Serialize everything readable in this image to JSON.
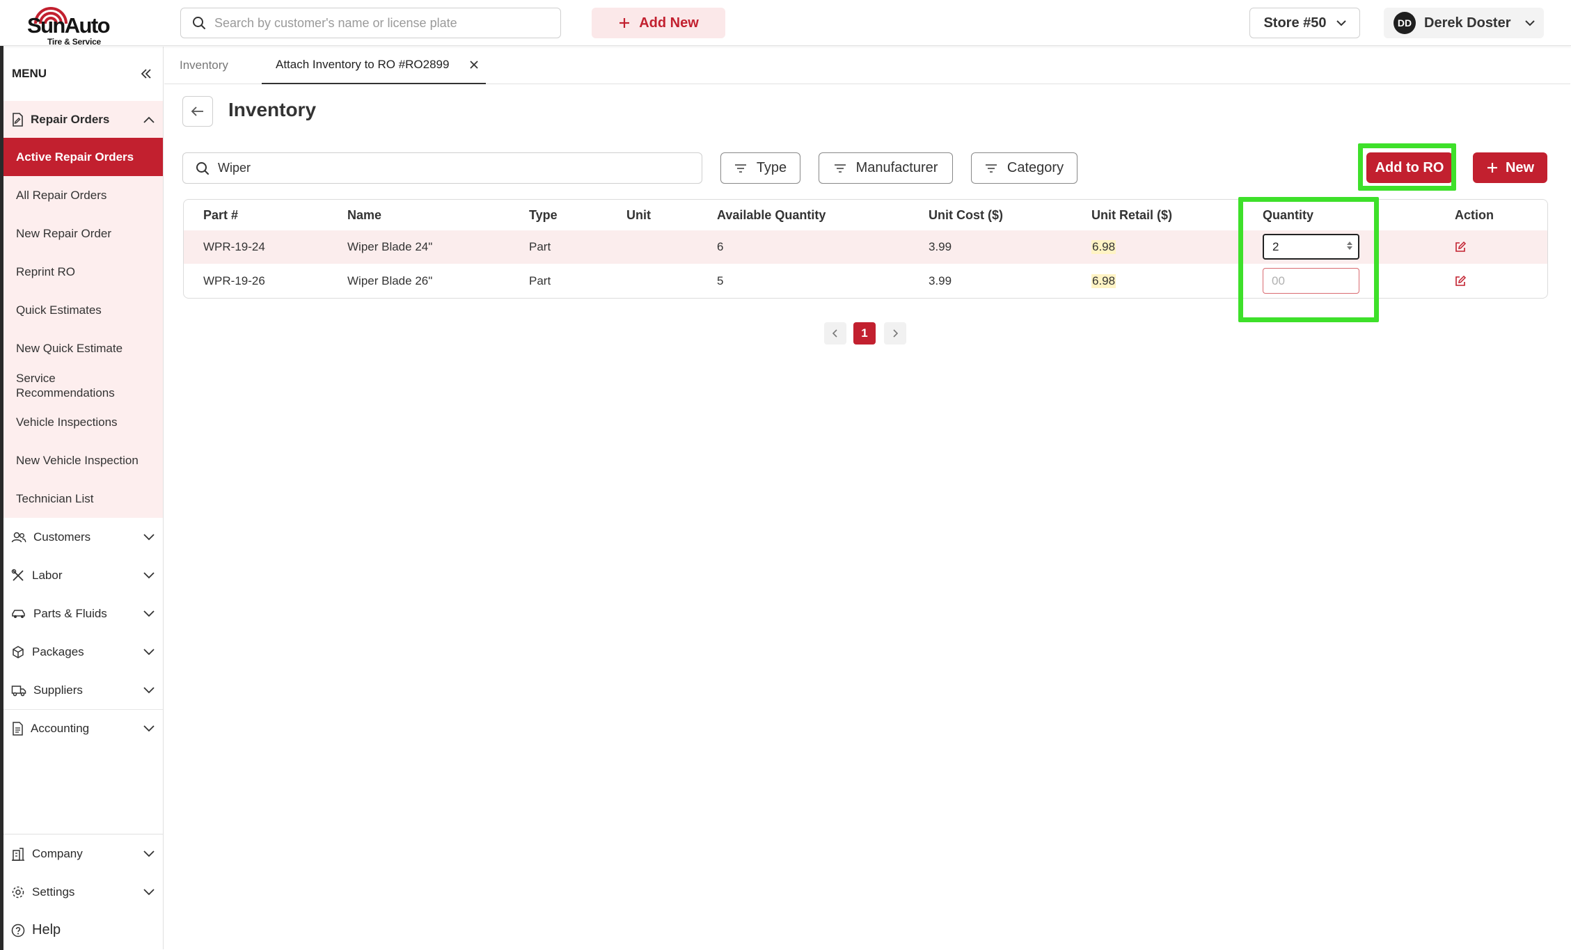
{
  "brand": {
    "name_part1": "Sun",
    "name_part2": "Auto",
    "tagline": "Tire & Service",
    "accent_color": "#c2202f"
  },
  "topbar": {
    "search_placeholder": "Search by customer's name or license plate",
    "add_new_label": "Add New",
    "store_label": "Store #50",
    "user_initials": "DD",
    "user_name": "Derek Doster"
  },
  "sidebar": {
    "menu_label": "MENU",
    "repair_orders": {
      "label": "Repair Orders",
      "items": [
        "Active Repair Orders",
        "All Repair Orders",
        "New Repair Order",
        "Reprint RO",
        "Quick Estimates",
        "New Quick Estimate",
        "Service Recommendations",
        "Vehicle Inspections",
        "New Vehicle Inspection",
        "Technician List"
      ],
      "active_item": "Active Repair Orders"
    },
    "groups": [
      "Customers",
      "Labor",
      "Parts & Fluids",
      "Packages",
      "Suppliers",
      "Accounting"
    ],
    "bottom_groups": [
      "Company",
      "Settings"
    ],
    "help_label": "Help"
  },
  "tabs": [
    {
      "label": "Inventory",
      "active": false
    },
    {
      "label": "Attach Inventory to RO #RO2899",
      "active": true
    }
  ],
  "main": {
    "title": "Inventory",
    "search_value": "Wiper",
    "filters": [
      "Type",
      "Manufacturer",
      "Category"
    ],
    "add_to_ro_label": "Add to RO",
    "new_label": "New"
  },
  "table": {
    "columns": [
      "Part #",
      "Name",
      "Type",
      "Unit",
      "Available Quantity",
      "Unit Cost ($)",
      "Unit Retail ($)",
      "Quantity",
      "Action"
    ],
    "rows": [
      {
        "part": "WPR-19-24",
        "name": "Wiper Blade 24\"",
        "type": "Part",
        "unit": "",
        "available": "6",
        "unit_cost": "3.99",
        "unit_retail": "6.98",
        "quantity": "2",
        "quantity_placeholder": "00"
      },
      {
        "part": "WPR-19-26",
        "name": "Wiper Blade 26\"",
        "type": "Part",
        "unit": "",
        "available": "5",
        "unit_cost": "3.99",
        "unit_retail": "6.98",
        "quantity": "",
        "quantity_placeholder": "00"
      }
    ]
  },
  "pagination": {
    "current_page": "1"
  }
}
